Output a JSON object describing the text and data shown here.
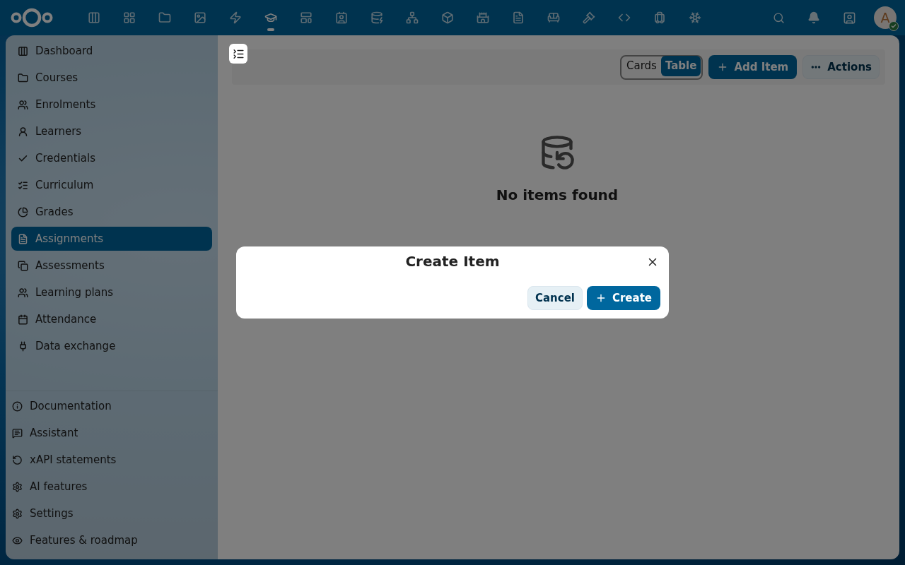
{
  "topbar": {
    "apps": [
      {
        "selected": false
      },
      {
        "selected": false
      },
      {
        "selected": false
      },
      {
        "selected": false
      },
      {
        "selected": false
      },
      {
        "selected": true
      },
      {
        "selected": false
      },
      {
        "selected": false
      },
      {
        "selected": false
      },
      {
        "selected": false
      },
      {
        "selected": false
      },
      {
        "selected": false
      },
      {
        "selected": false
      },
      {
        "selected": false
      },
      {
        "selected": false
      },
      {
        "selected": false
      },
      {
        "selected": false
      },
      {
        "selected": false
      }
    ],
    "avatar": {
      "initial": "A",
      "online": true
    }
  },
  "sidebar": {
    "items": [
      {
        "label": "Dashboard",
        "selected": false
      },
      {
        "label": "Courses",
        "selected": false
      },
      {
        "label": "Enrolments",
        "selected": false
      },
      {
        "label": "Learners",
        "selected": false
      },
      {
        "label": "Credentials",
        "selected": false
      },
      {
        "label": "Curriculum",
        "selected": false
      },
      {
        "label": "Grades",
        "selected": false
      },
      {
        "label": "Assignments",
        "selected": true
      },
      {
        "label": "Assessments",
        "selected": false
      },
      {
        "label": "Learning plans",
        "selected": false
      },
      {
        "label": "Attendance",
        "selected": false
      },
      {
        "label": "Data exchange",
        "selected": false
      }
    ],
    "footer_items": [
      {
        "label": "Documentation"
      },
      {
        "label": "Assistant"
      },
      {
        "label": "xAPI statements"
      },
      {
        "label": "AI features"
      },
      {
        "label": "Settings"
      },
      {
        "label": "Features & roadmap"
      }
    ]
  },
  "toolbar": {
    "view_toggle": [
      {
        "label": "Cards",
        "selected": false
      },
      {
        "label": "Table",
        "selected": true
      }
    ],
    "add_button": "Add Item",
    "actions_button": "Actions"
  },
  "empty_state": {
    "message": "No items found"
  },
  "dialog": {
    "title": "Create Item",
    "cancel": "Cancel",
    "create": "Create"
  }
}
